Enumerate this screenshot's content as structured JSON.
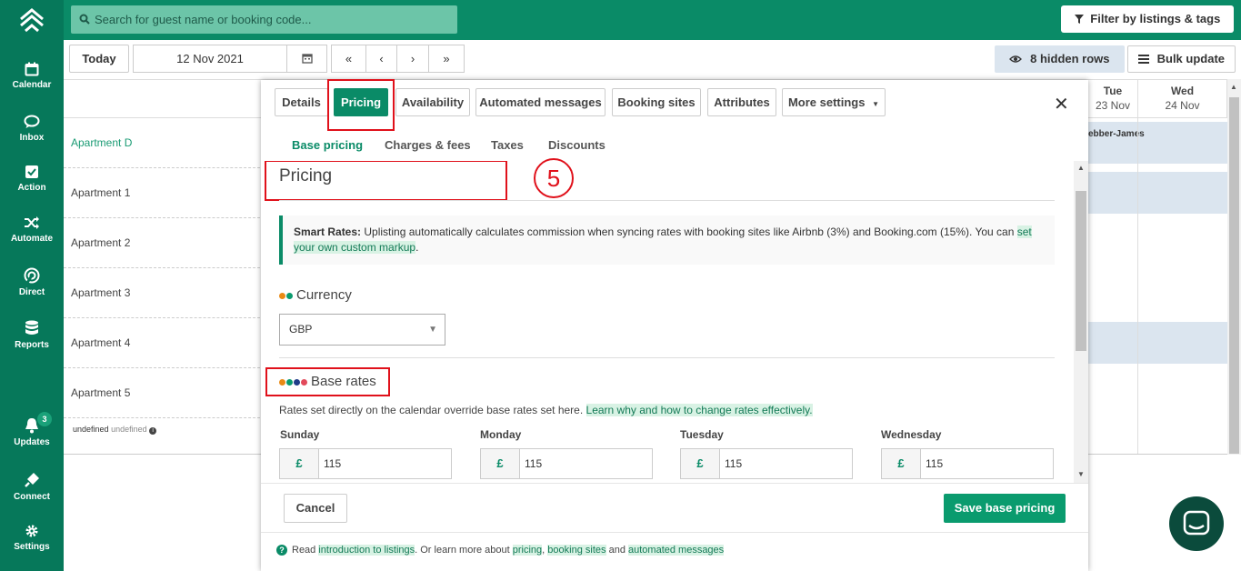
{
  "sidebar": {
    "items": [
      {
        "label": "Calendar",
        "icon": "calendar-icon"
      },
      {
        "label": "Inbox",
        "icon": "chat-icon"
      },
      {
        "label": "Action",
        "icon": "checkbox-icon"
      },
      {
        "label": "Automate",
        "icon": "shuffle-icon"
      },
      {
        "label": "Direct",
        "icon": "direct-icon"
      },
      {
        "label": "Reports",
        "icon": "database-icon"
      },
      {
        "label": "Updates",
        "icon": "bell-icon",
        "badge": "3"
      },
      {
        "label": "Connect",
        "icon": "plug-icon"
      },
      {
        "label": "Settings",
        "icon": "gear-icon"
      }
    ]
  },
  "topbar": {
    "search_placeholder": "Search for guest name or booking code...",
    "filter_label": "Filter by listings & tags"
  },
  "toolbar": {
    "today": "Today",
    "date": "12 Nov 2021",
    "first": "«",
    "prev": "‹",
    "next": "›",
    "last": "»",
    "hidden_rows": "8 hidden rows",
    "bulk_update": "Bulk update"
  },
  "calendar": {
    "apartments": [
      "Apartment D",
      "Apartment 1",
      "Apartment 2",
      "Apartment 3",
      "Apartment 4",
      "Apartment 5"
    ],
    "undefined_row": "undefined",
    "undefined_row_small": "undefined",
    "days": [
      {
        "name": "Tue",
        "date": "23 Nov"
      },
      {
        "name": "Wed",
        "date": "24 Nov"
      }
    ],
    "booking_guest": "ebber-James"
  },
  "modal": {
    "tabs": [
      "Details",
      "Pricing",
      "Availability",
      "Automated messages",
      "Booking sites",
      "Attributes",
      "More settings"
    ],
    "subtabs": [
      "Base pricing",
      "Charges & fees",
      "Taxes",
      "Discounts"
    ],
    "heading": "Pricing",
    "step_number": "5",
    "smart_rates": {
      "title": "Smart Rates:",
      "text": "Uplisting automatically calculates commission when syncing rates with booking sites like Airbnb (3%) and Booking.com (15%). You can",
      "link": "set your own custom markup",
      "end": "."
    },
    "currency_heading": "Currency",
    "currency_value": "GBP",
    "base_rates_heading": "Base rates",
    "base_rates_desc": "Rates set directly on the calendar override base rates set here.",
    "base_rates_link": "Learn why and how to change rates effectively.",
    "rates": [
      {
        "day": "Sunday",
        "symbol": "£",
        "value": "115"
      },
      {
        "day": "Monday",
        "symbol": "£",
        "value": "115"
      },
      {
        "day": "Tuesday",
        "symbol": "£",
        "value": "115"
      },
      {
        "day": "Wednesday",
        "symbol": "£",
        "value": "115"
      }
    ],
    "cancel": "Cancel",
    "save": "Save base pricing",
    "help": {
      "read": "Read",
      "intro_link": "introduction to listings",
      "middle": ". Or learn more about",
      "pricing_link": "pricing",
      "comma": ",",
      "booking_link": "booking sites",
      "and": "and",
      "automated_link": "automated messages"
    }
  },
  "colors": {
    "brand": "#0a8b67",
    "sidebar": "#06785a",
    "highlight": "#e0111b"
  }
}
